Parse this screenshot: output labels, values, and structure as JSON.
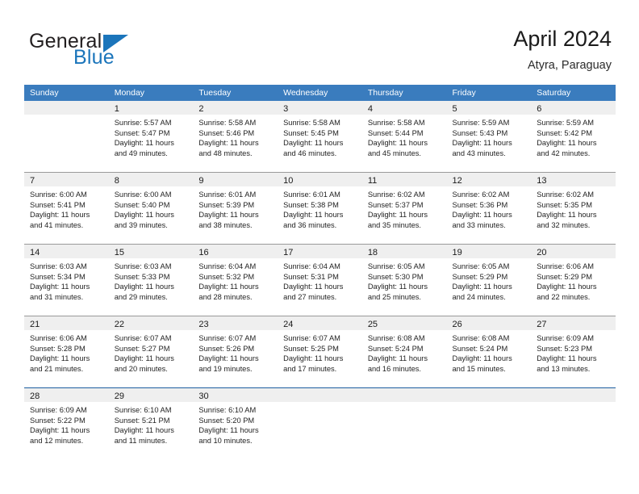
{
  "brand": {
    "name_top": "General",
    "name_bottom": "Blue",
    "triangle_color": "#1b75bb"
  },
  "header": {
    "title": "April 2024",
    "location": "Atyra, Paraguay"
  },
  "theme": {
    "header_bar": "#3a7cbe",
    "day_band": "#efefef",
    "week_rule": "#9a9a9a",
    "last_week_rule": "#1d5fa0"
  },
  "weekdays": [
    "Sunday",
    "Monday",
    "Tuesday",
    "Wednesday",
    "Thursday",
    "Friday",
    "Saturday"
  ],
  "weeks": [
    [
      {
        "day": "",
        "sunrise": "",
        "sunset": "",
        "daylight1": "",
        "daylight2": ""
      },
      {
        "day": "1",
        "sunrise": "Sunrise: 5:57 AM",
        "sunset": "Sunset: 5:47 PM",
        "daylight1": "Daylight: 11 hours",
        "daylight2": "and 49 minutes."
      },
      {
        "day": "2",
        "sunrise": "Sunrise: 5:58 AM",
        "sunset": "Sunset: 5:46 PM",
        "daylight1": "Daylight: 11 hours",
        "daylight2": "and 48 minutes."
      },
      {
        "day": "3",
        "sunrise": "Sunrise: 5:58 AM",
        "sunset": "Sunset: 5:45 PM",
        "daylight1": "Daylight: 11 hours",
        "daylight2": "and 46 minutes."
      },
      {
        "day": "4",
        "sunrise": "Sunrise: 5:58 AM",
        "sunset": "Sunset: 5:44 PM",
        "daylight1": "Daylight: 11 hours",
        "daylight2": "and 45 minutes."
      },
      {
        "day": "5",
        "sunrise": "Sunrise: 5:59 AM",
        "sunset": "Sunset: 5:43 PM",
        "daylight1": "Daylight: 11 hours",
        "daylight2": "and 43 minutes."
      },
      {
        "day": "6",
        "sunrise": "Sunrise: 5:59 AM",
        "sunset": "Sunset: 5:42 PM",
        "daylight1": "Daylight: 11 hours",
        "daylight2": "and 42 minutes."
      }
    ],
    [
      {
        "day": "7",
        "sunrise": "Sunrise: 6:00 AM",
        "sunset": "Sunset: 5:41 PM",
        "daylight1": "Daylight: 11 hours",
        "daylight2": "and 41 minutes."
      },
      {
        "day": "8",
        "sunrise": "Sunrise: 6:00 AM",
        "sunset": "Sunset: 5:40 PM",
        "daylight1": "Daylight: 11 hours",
        "daylight2": "and 39 minutes."
      },
      {
        "day": "9",
        "sunrise": "Sunrise: 6:01 AM",
        "sunset": "Sunset: 5:39 PM",
        "daylight1": "Daylight: 11 hours",
        "daylight2": "and 38 minutes."
      },
      {
        "day": "10",
        "sunrise": "Sunrise: 6:01 AM",
        "sunset": "Sunset: 5:38 PM",
        "daylight1": "Daylight: 11 hours",
        "daylight2": "and 36 minutes."
      },
      {
        "day": "11",
        "sunrise": "Sunrise: 6:02 AM",
        "sunset": "Sunset: 5:37 PM",
        "daylight1": "Daylight: 11 hours",
        "daylight2": "and 35 minutes."
      },
      {
        "day": "12",
        "sunrise": "Sunrise: 6:02 AM",
        "sunset": "Sunset: 5:36 PM",
        "daylight1": "Daylight: 11 hours",
        "daylight2": "and 33 minutes."
      },
      {
        "day": "13",
        "sunrise": "Sunrise: 6:02 AM",
        "sunset": "Sunset: 5:35 PM",
        "daylight1": "Daylight: 11 hours",
        "daylight2": "and 32 minutes."
      }
    ],
    [
      {
        "day": "14",
        "sunrise": "Sunrise: 6:03 AM",
        "sunset": "Sunset: 5:34 PM",
        "daylight1": "Daylight: 11 hours",
        "daylight2": "and 31 minutes."
      },
      {
        "day": "15",
        "sunrise": "Sunrise: 6:03 AM",
        "sunset": "Sunset: 5:33 PM",
        "daylight1": "Daylight: 11 hours",
        "daylight2": "and 29 minutes."
      },
      {
        "day": "16",
        "sunrise": "Sunrise: 6:04 AM",
        "sunset": "Sunset: 5:32 PM",
        "daylight1": "Daylight: 11 hours",
        "daylight2": "and 28 minutes."
      },
      {
        "day": "17",
        "sunrise": "Sunrise: 6:04 AM",
        "sunset": "Sunset: 5:31 PM",
        "daylight1": "Daylight: 11 hours",
        "daylight2": "and 27 minutes."
      },
      {
        "day": "18",
        "sunrise": "Sunrise: 6:05 AM",
        "sunset": "Sunset: 5:30 PM",
        "daylight1": "Daylight: 11 hours",
        "daylight2": "and 25 minutes."
      },
      {
        "day": "19",
        "sunrise": "Sunrise: 6:05 AM",
        "sunset": "Sunset: 5:29 PM",
        "daylight1": "Daylight: 11 hours",
        "daylight2": "and 24 minutes."
      },
      {
        "day": "20",
        "sunrise": "Sunrise: 6:06 AM",
        "sunset": "Sunset: 5:29 PM",
        "daylight1": "Daylight: 11 hours",
        "daylight2": "and 22 minutes."
      }
    ],
    [
      {
        "day": "21",
        "sunrise": "Sunrise: 6:06 AM",
        "sunset": "Sunset: 5:28 PM",
        "daylight1": "Daylight: 11 hours",
        "daylight2": "and 21 minutes."
      },
      {
        "day": "22",
        "sunrise": "Sunrise: 6:07 AM",
        "sunset": "Sunset: 5:27 PM",
        "daylight1": "Daylight: 11 hours",
        "daylight2": "and 20 minutes."
      },
      {
        "day": "23",
        "sunrise": "Sunrise: 6:07 AM",
        "sunset": "Sunset: 5:26 PM",
        "daylight1": "Daylight: 11 hours",
        "daylight2": "and 19 minutes."
      },
      {
        "day": "24",
        "sunrise": "Sunrise: 6:07 AM",
        "sunset": "Sunset: 5:25 PM",
        "daylight1": "Daylight: 11 hours",
        "daylight2": "and 17 minutes."
      },
      {
        "day": "25",
        "sunrise": "Sunrise: 6:08 AM",
        "sunset": "Sunset: 5:24 PM",
        "daylight1": "Daylight: 11 hours",
        "daylight2": "and 16 minutes."
      },
      {
        "day": "26",
        "sunrise": "Sunrise: 6:08 AM",
        "sunset": "Sunset: 5:24 PM",
        "daylight1": "Daylight: 11 hours",
        "daylight2": "and 15 minutes."
      },
      {
        "day": "27",
        "sunrise": "Sunrise: 6:09 AM",
        "sunset": "Sunset: 5:23 PM",
        "daylight1": "Daylight: 11 hours",
        "daylight2": "and 13 minutes."
      }
    ],
    [
      {
        "day": "28",
        "sunrise": "Sunrise: 6:09 AM",
        "sunset": "Sunset: 5:22 PM",
        "daylight1": "Daylight: 11 hours",
        "daylight2": "and 12 minutes."
      },
      {
        "day": "29",
        "sunrise": "Sunrise: 6:10 AM",
        "sunset": "Sunset: 5:21 PM",
        "daylight1": "Daylight: 11 hours",
        "daylight2": "and 11 minutes."
      },
      {
        "day": "30",
        "sunrise": "Sunrise: 6:10 AM",
        "sunset": "Sunset: 5:20 PM",
        "daylight1": "Daylight: 11 hours",
        "daylight2": "and 10 minutes."
      },
      {
        "day": "",
        "sunrise": "",
        "sunset": "",
        "daylight1": "",
        "daylight2": ""
      },
      {
        "day": "",
        "sunrise": "",
        "sunset": "",
        "daylight1": "",
        "daylight2": ""
      },
      {
        "day": "",
        "sunrise": "",
        "sunset": "",
        "daylight1": "",
        "daylight2": ""
      },
      {
        "day": "",
        "sunrise": "",
        "sunset": "",
        "daylight1": "",
        "daylight2": ""
      }
    ]
  ]
}
